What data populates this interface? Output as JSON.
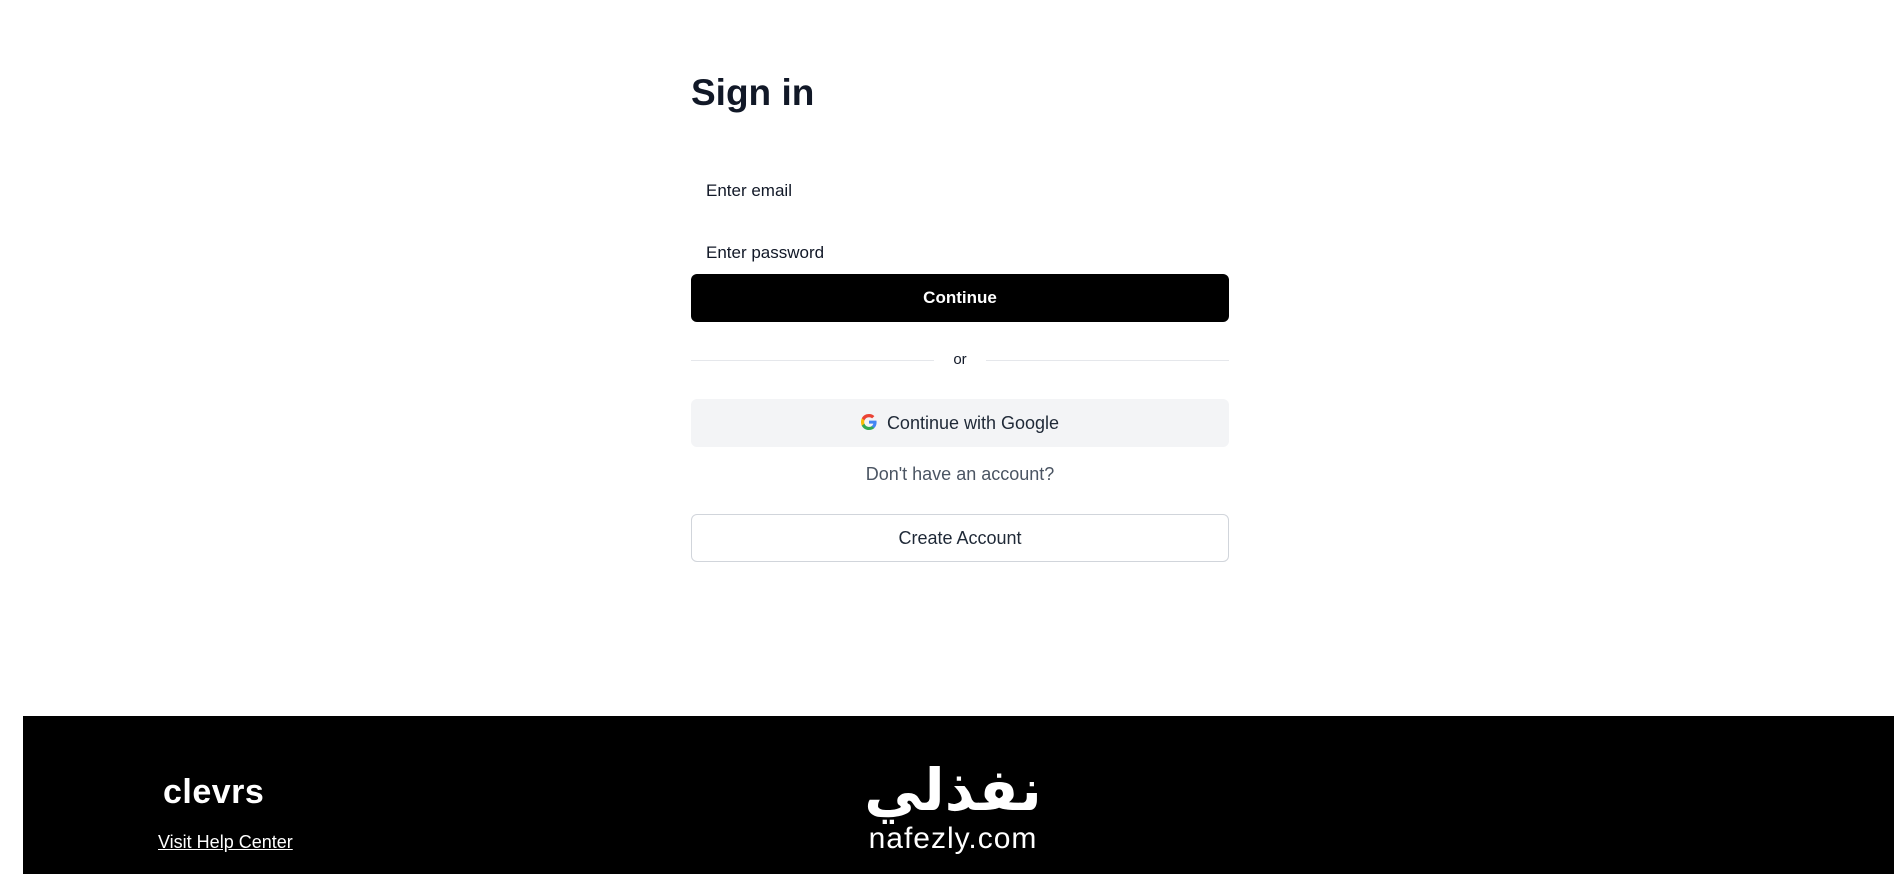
{
  "signin": {
    "title": "Sign in",
    "email_placeholder": "Enter email",
    "password_placeholder": "Enter password",
    "continue_label": "Continue",
    "divider_text": "or",
    "google_label": "Continue with Google",
    "google_icon": "google-icon",
    "no_account_text": "Don't have an account?",
    "create_account_label": "Create Account"
  },
  "footer": {
    "brand": "clevrs",
    "help_link": "Visit Help Center",
    "partner_logo_ar": "نفذلي",
    "partner_logo_en": "nafezly.com"
  },
  "colors": {
    "primary_button": "#000000",
    "google_button_bg": "#f3f4f6",
    "footer_bg": "#000000",
    "brand_accent": "#4f46e5"
  }
}
